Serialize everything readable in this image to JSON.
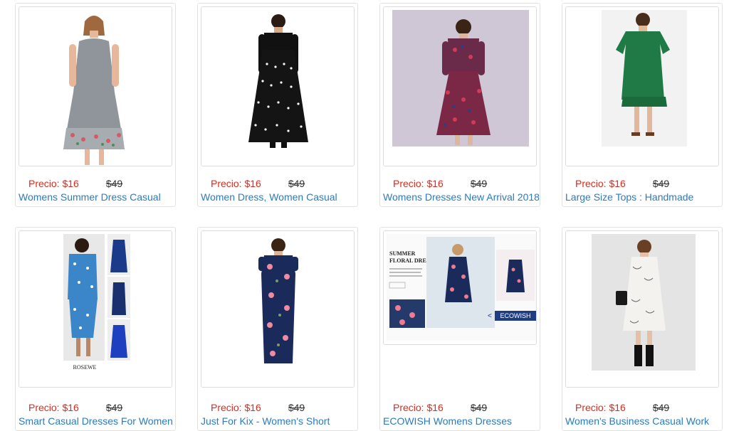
{
  "products": [
    {
      "price": "Precio: $16",
      "old_price": "$49",
      "title": "Womens Summer Dress Casual",
      "image": "grey-floral-sleeveless-dress"
    },
    {
      "price": "Precio: $16",
      "old_price": "$49",
      "title": "Women Dress, Women Casual",
      "image": "black-polka-dot-maxi-dress"
    },
    {
      "price": "Precio: $16",
      "old_price": "$49",
      "title": "Womens Dresses New Arrival 2018",
      "image": "burgundy-floral-midi-dress"
    },
    {
      "price": "Precio: $16",
      "old_price": "$49",
      "title": "Large Size Tops : Handmade",
      "image": "green-loose-dress"
    },
    {
      "price": "Precio: $16",
      "old_price": "$49",
      "title": "Smart Casual Dresses For Women",
      "image": "blue-polka-dot-wrap-dress",
      "image_text": "ROSEWE"
    },
    {
      "price": "Precio: $16",
      "old_price": "$49",
      "title": "Just For Kix - Women's Short",
      "image": "navy-floral-maxi-dress"
    },
    {
      "price": "Precio: $16",
      "old_price": "$49",
      "title": "ECOWISH Womens Dresses",
      "image": "summer-floral-dress-banner",
      "image_text": {
        "heading": "SUMMER FLORAL DRESS",
        "badge": "ECOWISH"
      }
    },
    {
      "price": "Precio: $16",
      "old_price": "$49",
      "title": "Women's Business Casual Work",
      "image": "white-print-shirt-dress"
    }
  ],
  "colors": {
    "price": "#e0281c",
    "link": "#2a7bbf",
    "border": "#e3e3e3"
  }
}
